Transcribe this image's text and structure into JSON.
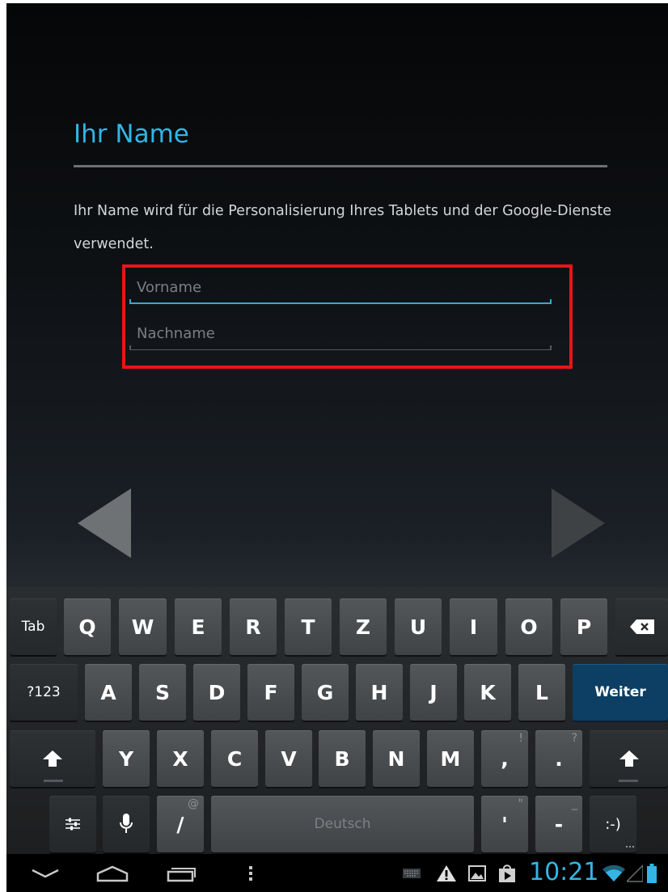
{
  "page": {
    "title": "Ihr Name",
    "description": "Ihr Name wird für die Personalisierung Ihres Tablets und der Google-Dienste verwendet."
  },
  "form": {
    "first_name": {
      "placeholder": "Vorname",
      "value": ""
    },
    "last_name": {
      "placeholder": "Nachname",
      "value": ""
    }
  },
  "nav": {
    "back_icon": "left-triangle-icon",
    "next_icon": "right-triangle-icon"
  },
  "keyboard": {
    "tab_label": "Tab",
    "row1": [
      "Q",
      "W",
      "E",
      "R",
      "T",
      "Z",
      "U",
      "I",
      "O",
      "P"
    ],
    "symbols_label": "?123",
    "row2": [
      "A",
      "S",
      "D",
      "F",
      "G",
      "H",
      "J",
      "K",
      "L"
    ],
    "action_label": "Weiter",
    "row3": [
      "Y",
      "X",
      "C",
      "V",
      "B",
      "N",
      "M"
    ],
    "comma_key": ",",
    "comma_hint": "!",
    "period_key": ".",
    "period_hint": "?",
    "slash_key": "/",
    "slash_hint": "@",
    "space_label": "Deutsch",
    "apostrophe_key": "'",
    "apostrophe_hint": "\"",
    "dash_key": "-",
    "dash_hint": "_",
    "smiley_label": ":-)"
  },
  "status": {
    "time": "10:21"
  },
  "colors": {
    "accent": "#33b5e5",
    "action_key": "#0c3f63",
    "highlight": "#e8141a"
  }
}
